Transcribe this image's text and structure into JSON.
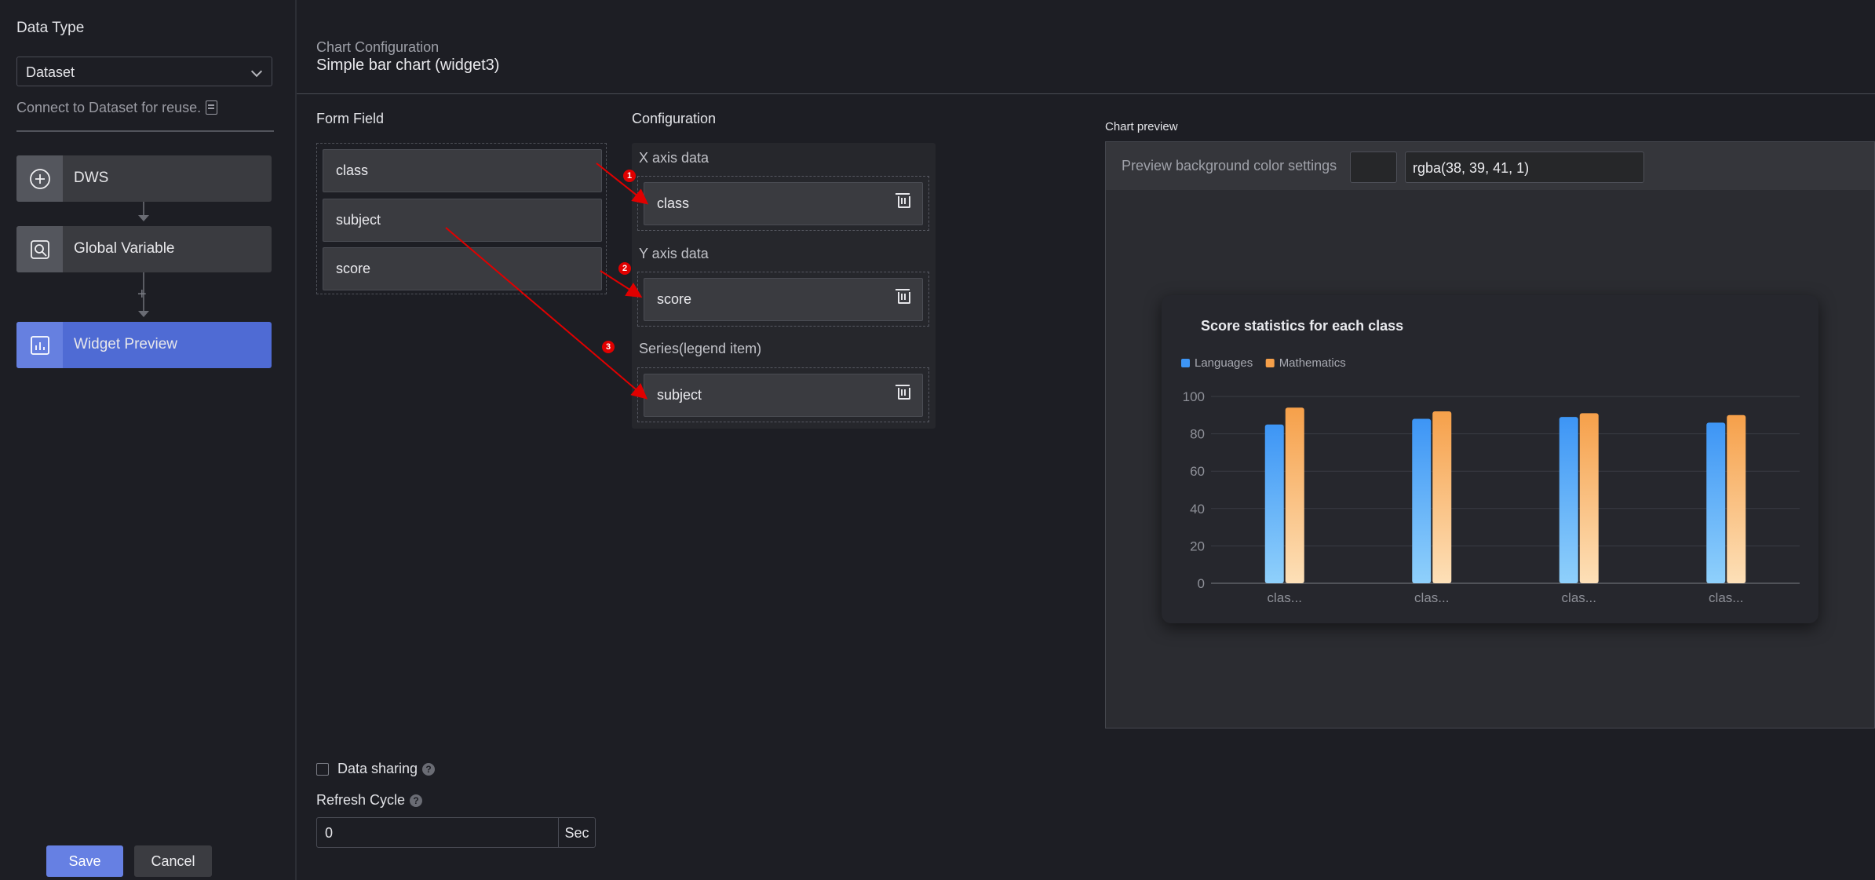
{
  "sidebar": {
    "data_type_label": "Data Type",
    "data_type_value": "Dataset",
    "hint": "Connect to Dataset for reuse.",
    "steps": [
      {
        "label": "DWS",
        "icon": "plus-circle-icon"
      },
      {
        "label": "Global Variable",
        "icon": "search-variable-icon"
      },
      {
        "label": "Widget Preview",
        "icon": "chart-icon",
        "active": true
      }
    ],
    "save_label": "Save",
    "cancel_label": "Cancel"
  },
  "header": {
    "subtitle": "Chart Configuration",
    "title": "Simple bar chart (widget3)"
  },
  "form_field": {
    "title": "Form Field",
    "items": [
      "class",
      "subject",
      "score"
    ]
  },
  "configuration": {
    "title": "Configuration",
    "x_axis_label": "X axis data",
    "x_axis_value": "class",
    "y_axis_label": "Y axis data",
    "y_axis_value": "score",
    "series_label": "Series(legend item)",
    "series_value": "subject"
  },
  "annotations": {
    "badges": [
      "1",
      "2",
      "3"
    ],
    "arrow_color": "#e00000"
  },
  "data_sharing": {
    "label": "Data sharing",
    "checked": false
  },
  "refresh": {
    "label": "Refresh Cycle",
    "value": "0",
    "unit": "Sec"
  },
  "preview": {
    "title": "Chart preview",
    "bg_label": "Preview background color settings",
    "bg_value": "rgba(38, 39, 41, 1)"
  },
  "chart_data": {
    "type": "bar",
    "title": "Score statistics for each class",
    "categories": [
      "clas...",
      "clas...",
      "clas...",
      "clas..."
    ],
    "series": [
      {
        "name": "Languages",
        "values": [
          85,
          88,
          89,
          86
        ],
        "color": "#3d95f5"
      },
      {
        "name": "Mathematics",
        "values": [
          94,
          92,
          91,
          90
        ],
        "color": "#f6a04a"
      }
    ],
    "ylim": [
      0,
      100
    ],
    "yticks": [
      "100",
      "80",
      "60",
      "40",
      "20",
      "0"
    ],
    "grid": true,
    "legend_position": "top-left"
  }
}
